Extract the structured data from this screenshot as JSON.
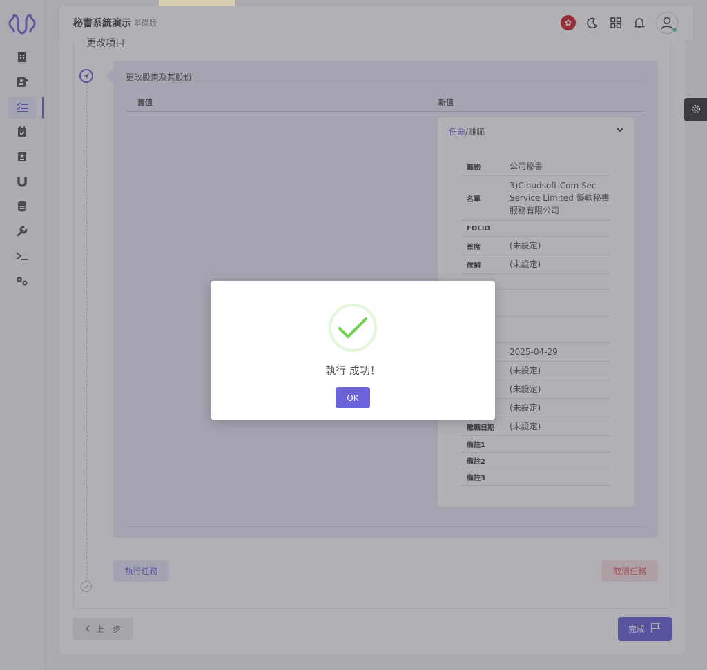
{
  "app": {
    "title": "秘書系統演示",
    "edition": "基礎版"
  },
  "header": {
    "icons": [
      "hk-flag-icon",
      "moon-icon",
      "grid-icon",
      "bell-icon",
      "user-avatar-icon"
    ]
  },
  "sidebar": {
    "items": [
      {
        "name": "building-icon"
      },
      {
        "name": "contacts-icon"
      },
      {
        "name": "tasks-icon",
        "active": true
      },
      {
        "name": "calendar-check-icon"
      },
      {
        "name": "address-book-icon"
      },
      {
        "name": "magnet-icon"
      },
      {
        "name": "database-icon"
      },
      {
        "name": "wrench-icon"
      },
      {
        "name": "terminal-icon"
      },
      {
        "name": "cogs-icon"
      }
    ]
  },
  "main": {
    "section_title": "更改項目",
    "step_title": "更改股東及其股份",
    "col_old": "舊值",
    "col_new": "新值",
    "detail": {
      "tab_active": "任命",
      "tab_sep": "/",
      "tab_inactive": "離職",
      "rows": [
        {
          "label": "職務",
          "value": "公司秘書"
        },
        {
          "label": "名單",
          "value": "3)Cloudsoft Com Sec Service Limited 優軟秘書服務有限公司"
        },
        {
          "label": "FOLIO",
          "value": ""
        },
        {
          "label": "首席",
          "value": "(未設定)"
        },
        {
          "label": "候補",
          "value": "(未設定)"
        },
        {
          "label": "",
          "value": ""
        },
        {
          "label": "",
          "value": ""
        },
        {
          "label": "",
          "value": ""
        },
        {
          "label": "",
          "value": "2025-04-29"
        },
        {
          "label": "",
          "value": "(未設定)"
        },
        {
          "label": "",
          "value": "(未設定)"
        },
        {
          "label": "",
          "value": "(未設定)"
        },
        {
          "label": "離職日期",
          "value": "(未設定)"
        },
        {
          "label": "備註1",
          "value": ""
        },
        {
          "label": "備註2",
          "value": ""
        },
        {
          "label": "備註3",
          "value": ""
        }
      ]
    },
    "btn_exec": "執行任務",
    "btn_cancel": "取消任務",
    "btn_prev": "上一步",
    "btn_finish": "完成"
  },
  "modal": {
    "message": "執行 成功！",
    "ok_label": "OK"
  },
  "colors": {
    "accent": "#6b63d9",
    "success": "#6fd04b",
    "danger": "#e45a5a"
  }
}
